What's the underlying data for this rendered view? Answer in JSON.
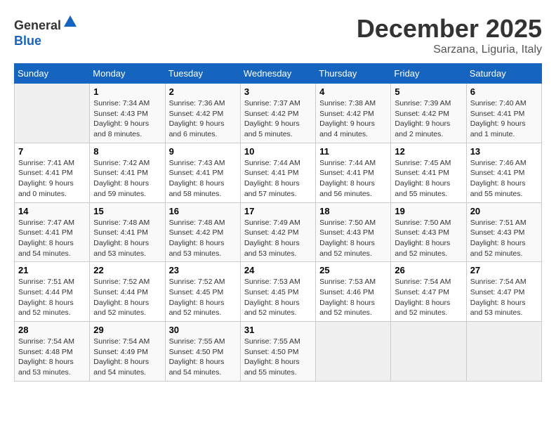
{
  "header": {
    "logo_line1": "General",
    "logo_line2": "Blue",
    "month": "December 2025",
    "location": "Sarzana, Liguria, Italy"
  },
  "days_of_week": [
    "Sunday",
    "Monday",
    "Tuesday",
    "Wednesday",
    "Thursday",
    "Friday",
    "Saturday"
  ],
  "weeks": [
    [
      {
        "num": "",
        "sunrise": "",
        "sunset": "",
        "daylight": ""
      },
      {
        "num": "1",
        "sunrise": "Sunrise: 7:34 AM",
        "sunset": "Sunset: 4:43 PM",
        "daylight": "Daylight: 9 hours and 8 minutes."
      },
      {
        "num": "2",
        "sunrise": "Sunrise: 7:36 AM",
        "sunset": "Sunset: 4:42 PM",
        "daylight": "Daylight: 9 hours and 6 minutes."
      },
      {
        "num": "3",
        "sunrise": "Sunrise: 7:37 AM",
        "sunset": "Sunset: 4:42 PM",
        "daylight": "Daylight: 9 hours and 5 minutes."
      },
      {
        "num": "4",
        "sunrise": "Sunrise: 7:38 AM",
        "sunset": "Sunset: 4:42 PM",
        "daylight": "Daylight: 9 hours and 4 minutes."
      },
      {
        "num": "5",
        "sunrise": "Sunrise: 7:39 AM",
        "sunset": "Sunset: 4:42 PM",
        "daylight": "Daylight: 9 hours and 2 minutes."
      },
      {
        "num": "6",
        "sunrise": "Sunrise: 7:40 AM",
        "sunset": "Sunset: 4:41 PM",
        "daylight": "Daylight: 9 hours and 1 minute."
      }
    ],
    [
      {
        "num": "7",
        "sunrise": "Sunrise: 7:41 AM",
        "sunset": "Sunset: 4:41 PM",
        "daylight": "Daylight: 9 hours and 0 minutes."
      },
      {
        "num": "8",
        "sunrise": "Sunrise: 7:42 AM",
        "sunset": "Sunset: 4:41 PM",
        "daylight": "Daylight: 8 hours and 59 minutes."
      },
      {
        "num": "9",
        "sunrise": "Sunrise: 7:43 AM",
        "sunset": "Sunset: 4:41 PM",
        "daylight": "Daylight: 8 hours and 58 minutes."
      },
      {
        "num": "10",
        "sunrise": "Sunrise: 7:44 AM",
        "sunset": "Sunset: 4:41 PM",
        "daylight": "Daylight: 8 hours and 57 minutes."
      },
      {
        "num": "11",
        "sunrise": "Sunrise: 7:44 AM",
        "sunset": "Sunset: 4:41 PM",
        "daylight": "Daylight: 8 hours and 56 minutes."
      },
      {
        "num": "12",
        "sunrise": "Sunrise: 7:45 AM",
        "sunset": "Sunset: 4:41 PM",
        "daylight": "Daylight: 8 hours and 55 minutes."
      },
      {
        "num": "13",
        "sunrise": "Sunrise: 7:46 AM",
        "sunset": "Sunset: 4:41 PM",
        "daylight": "Daylight: 8 hours and 55 minutes."
      }
    ],
    [
      {
        "num": "14",
        "sunrise": "Sunrise: 7:47 AM",
        "sunset": "Sunset: 4:41 PM",
        "daylight": "Daylight: 8 hours and 54 minutes."
      },
      {
        "num": "15",
        "sunrise": "Sunrise: 7:48 AM",
        "sunset": "Sunset: 4:41 PM",
        "daylight": "Daylight: 8 hours and 53 minutes."
      },
      {
        "num": "16",
        "sunrise": "Sunrise: 7:48 AM",
        "sunset": "Sunset: 4:42 PM",
        "daylight": "Daylight: 8 hours and 53 minutes."
      },
      {
        "num": "17",
        "sunrise": "Sunrise: 7:49 AM",
        "sunset": "Sunset: 4:42 PM",
        "daylight": "Daylight: 8 hours and 53 minutes."
      },
      {
        "num": "18",
        "sunrise": "Sunrise: 7:50 AM",
        "sunset": "Sunset: 4:43 PM",
        "daylight": "Daylight: 8 hours and 52 minutes."
      },
      {
        "num": "19",
        "sunrise": "Sunrise: 7:50 AM",
        "sunset": "Sunset: 4:43 PM",
        "daylight": "Daylight: 8 hours and 52 minutes."
      },
      {
        "num": "20",
        "sunrise": "Sunrise: 7:51 AM",
        "sunset": "Sunset: 4:43 PM",
        "daylight": "Daylight: 8 hours and 52 minutes."
      }
    ],
    [
      {
        "num": "21",
        "sunrise": "Sunrise: 7:51 AM",
        "sunset": "Sunset: 4:44 PM",
        "daylight": "Daylight: 8 hours and 52 minutes."
      },
      {
        "num": "22",
        "sunrise": "Sunrise: 7:52 AM",
        "sunset": "Sunset: 4:44 PM",
        "daylight": "Daylight: 8 hours and 52 minutes."
      },
      {
        "num": "23",
        "sunrise": "Sunrise: 7:52 AM",
        "sunset": "Sunset: 4:45 PM",
        "daylight": "Daylight: 8 hours and 52 minutes."
      },
      {
        "num": "24",
        "sunrise": "Sunrise: 7:53 AM",
        "sunset": "Sunset: 4:45 PM",
        "daylight": "Daylight: 8 hours and 52 minutes."
      },
      {
        "num": "25",
        "sunrise": "Sunrise: 7:53 AM",
        "sunset": "Sunset: 4:46 PM",
        "daylight": "Daylight: 8 hours and 52 minutes."
      },
      {
        "num": "26",
        "sunrise": "Sunrise: 7:54 AM",
        "sunset": "Sunset: 4:47 PM",
        "daylight": "Daylight: 8 hours and 52 minutes."
      },
      {
        "num": "27",
        "sunrise": "Sunrise: 7:54 AM",
        "sunset": "Sunset: 4:47 PM",
        "daylight": "Daylight: 8 hours and 53 minutes."
      }
    ],
    [
      {
        "num": "28",
        "sunrise": "Sunrise: 7:54 AM",
        "sunset": "Sunset: 4:48 PM",
        "daylight": "Daylight: 8 hours and 53 minutes."
      },
      {
        "num": "29",
        "sunrise": "Sunrise: 7:54 AM",
        "sunset": "Sunset: 4:49 PM",
        "daylight": "Daylight: 8 hours and 54 minutes."
      },
      {
        "num": "30",
        "sunrise": "Sunrise: 7:55 AM",
        "sunset": "Sunset: 4:50 PM",
        "daylight": "Daylight: 8 hours and 54 minutes."
      },
      {
        "num": "31",
        "sunrise": "Sunrise: 7:55 AM",
        "sunset": "Sunset: 4:50 PM",
        "daylight": "Daylight: 8 hours and 55 minutes."
      },
      {
        "num": "",
        "sunrise": "",
        "sunset": "",
        "daylight": ""
      },
      {
        "num": "",
        "sunrise": "",
        "sunset": "",
        "daylight": ""
      },
      {
        "num": "",
        "sunrise": "",
        "sunset": "",
        "daylight": ""
      }
    ]
  ]
}
